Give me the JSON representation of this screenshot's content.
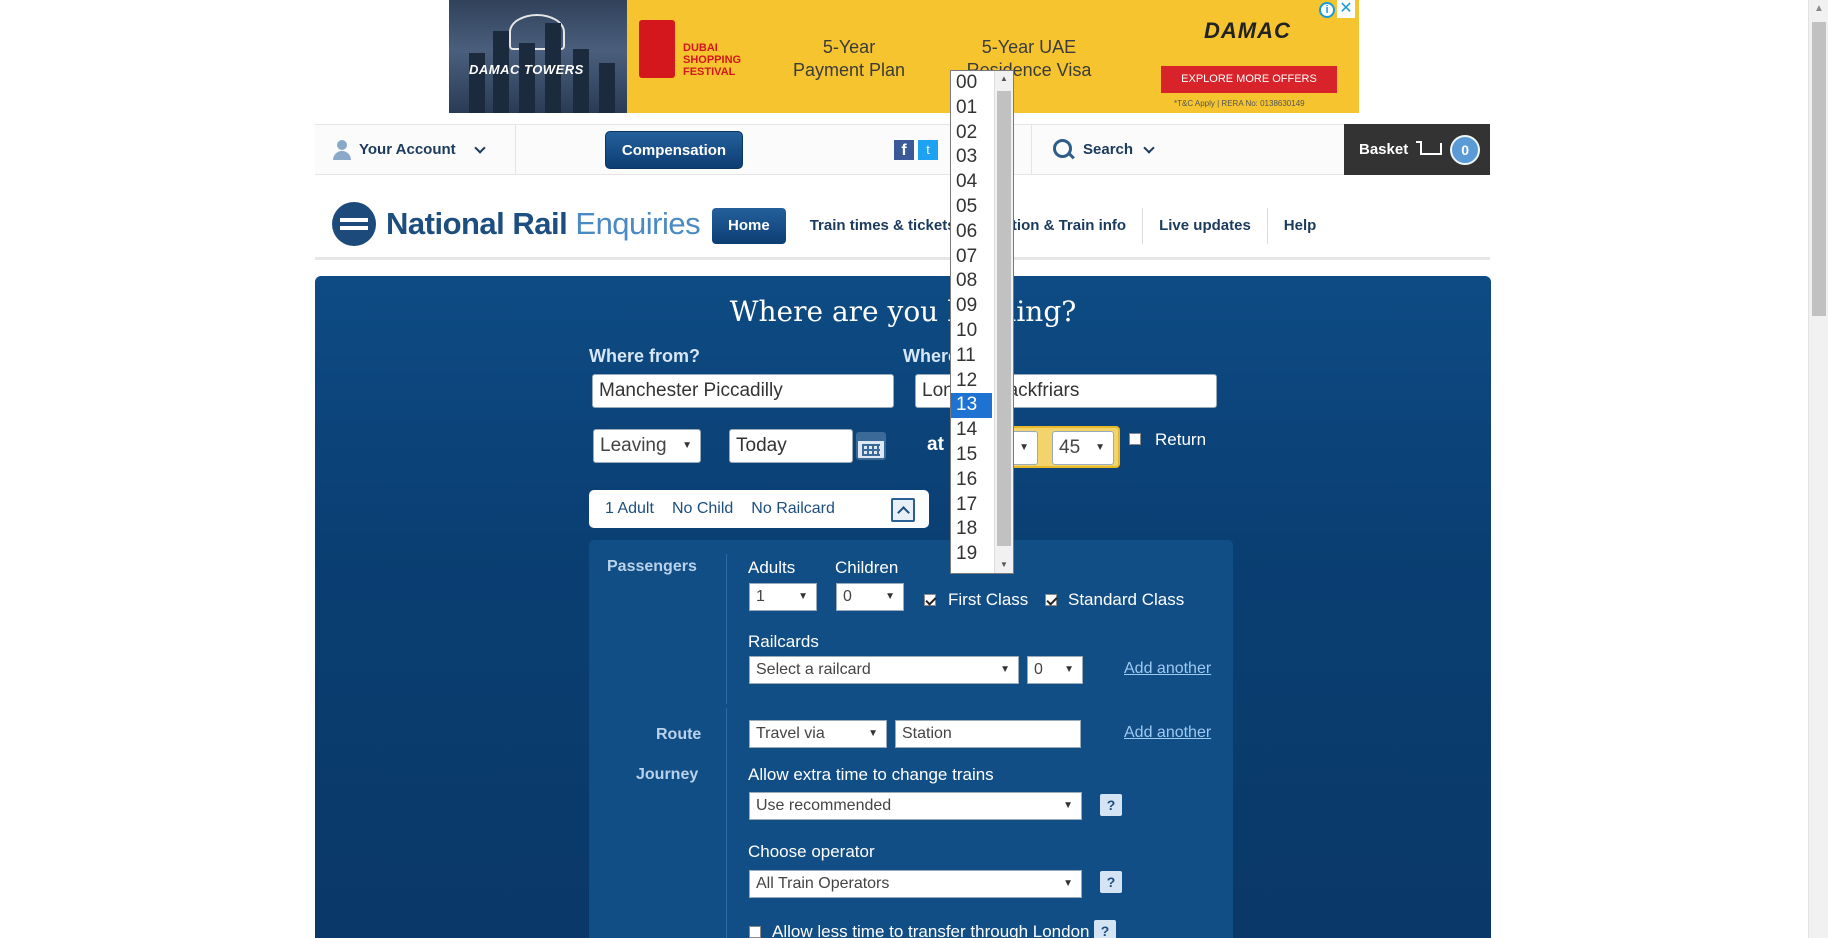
{
  "ad": {
    "brand": "DAMAC TOWERS",
    "festival": "DUBAI SHOPPING FESTIVAL",
    "offer1_line1": "5-Year",
    "offer1_line2": "Payment Plan",
    "offer2_line1": "5-Year UAE",
    "offer2_line2": "Residence Visa",
    "logo": "DAMAC",
    "cta": "EXPLORE MORE OFFERS",
    "fineprint": "*T&C Apply | RERA No: 0138630149",
    "adchoices": "i",
    "close": "✕"
  },
  "utilbar": {
    "account": "Your Account",
    "compensation": "Compensation",
    "facebook": "f",
    "twitter": "t",
    "search": "Search",
    "basket": "Basket",
    "basket_count": "0"
  },
  "header": {
    "logo_bold": "National Rail",
    "logo_light": "Enquiries",
    "nav": [
      "Home",
      "Train times & tickets",
      "Station & Train info",
      "Live updates",
      "Help"
    ]
  },
  "planner": {
    "title": "Where are you heading?",
    "from_label": "Where from?",
    "from_value": "Manchester Piccadilly",
    "to_label": "Where to?",
    "to_value": "London Blackfriars",
    "leaving": "Leaving",
    "date": "Today",
    "at": "at",
    "hour": "13",
    "minute": "45",
    "return_label": "Return",
    "summary": {
      "adults": "1 Adult",
      "children": "No Child",
      "railcard": "No Railcard"
    }
  },
  "options": {
    "passengers_label": "Passengers",
    "adults_label": "Adults",
    "adults_value": "1",
    "children_label": "Children",
    "children_value": "0",
    "first_class": "First Class",
    "standard_class": "Standard Class",
    "railcards_label": "Railcards",
    "railcard_select": "Select a railcard",
    "railcard_count": "0",
    "add_another": "Add another",
    "route_label": "Route",
    "travel_via": "Travel via",
    "station_placeholder": "Station",
    "journey_label": "Journey",
    "extra_time_label": "Allow extra time to change trains",
    "extra_time_value": "Use recommended",
    "operator_label": "Choose operator",
    "operator_value": "All Train Operators",
    "london_transfer": "Allow less time to transfer through London",
    "help": "?"
  },
  "hours_dropdown": {
    "options": [
      "00",
      "01",
      "02",
      "03",
      "04",
      "05",
      "06",
      "07",
      "08",
      "09",
      "10",
      "11",
      "12",
      "13",
      "14",
      "15",
      "16",
      "17",
      "18",
      "19"
    ],
    "selected": "13"
  }
}
